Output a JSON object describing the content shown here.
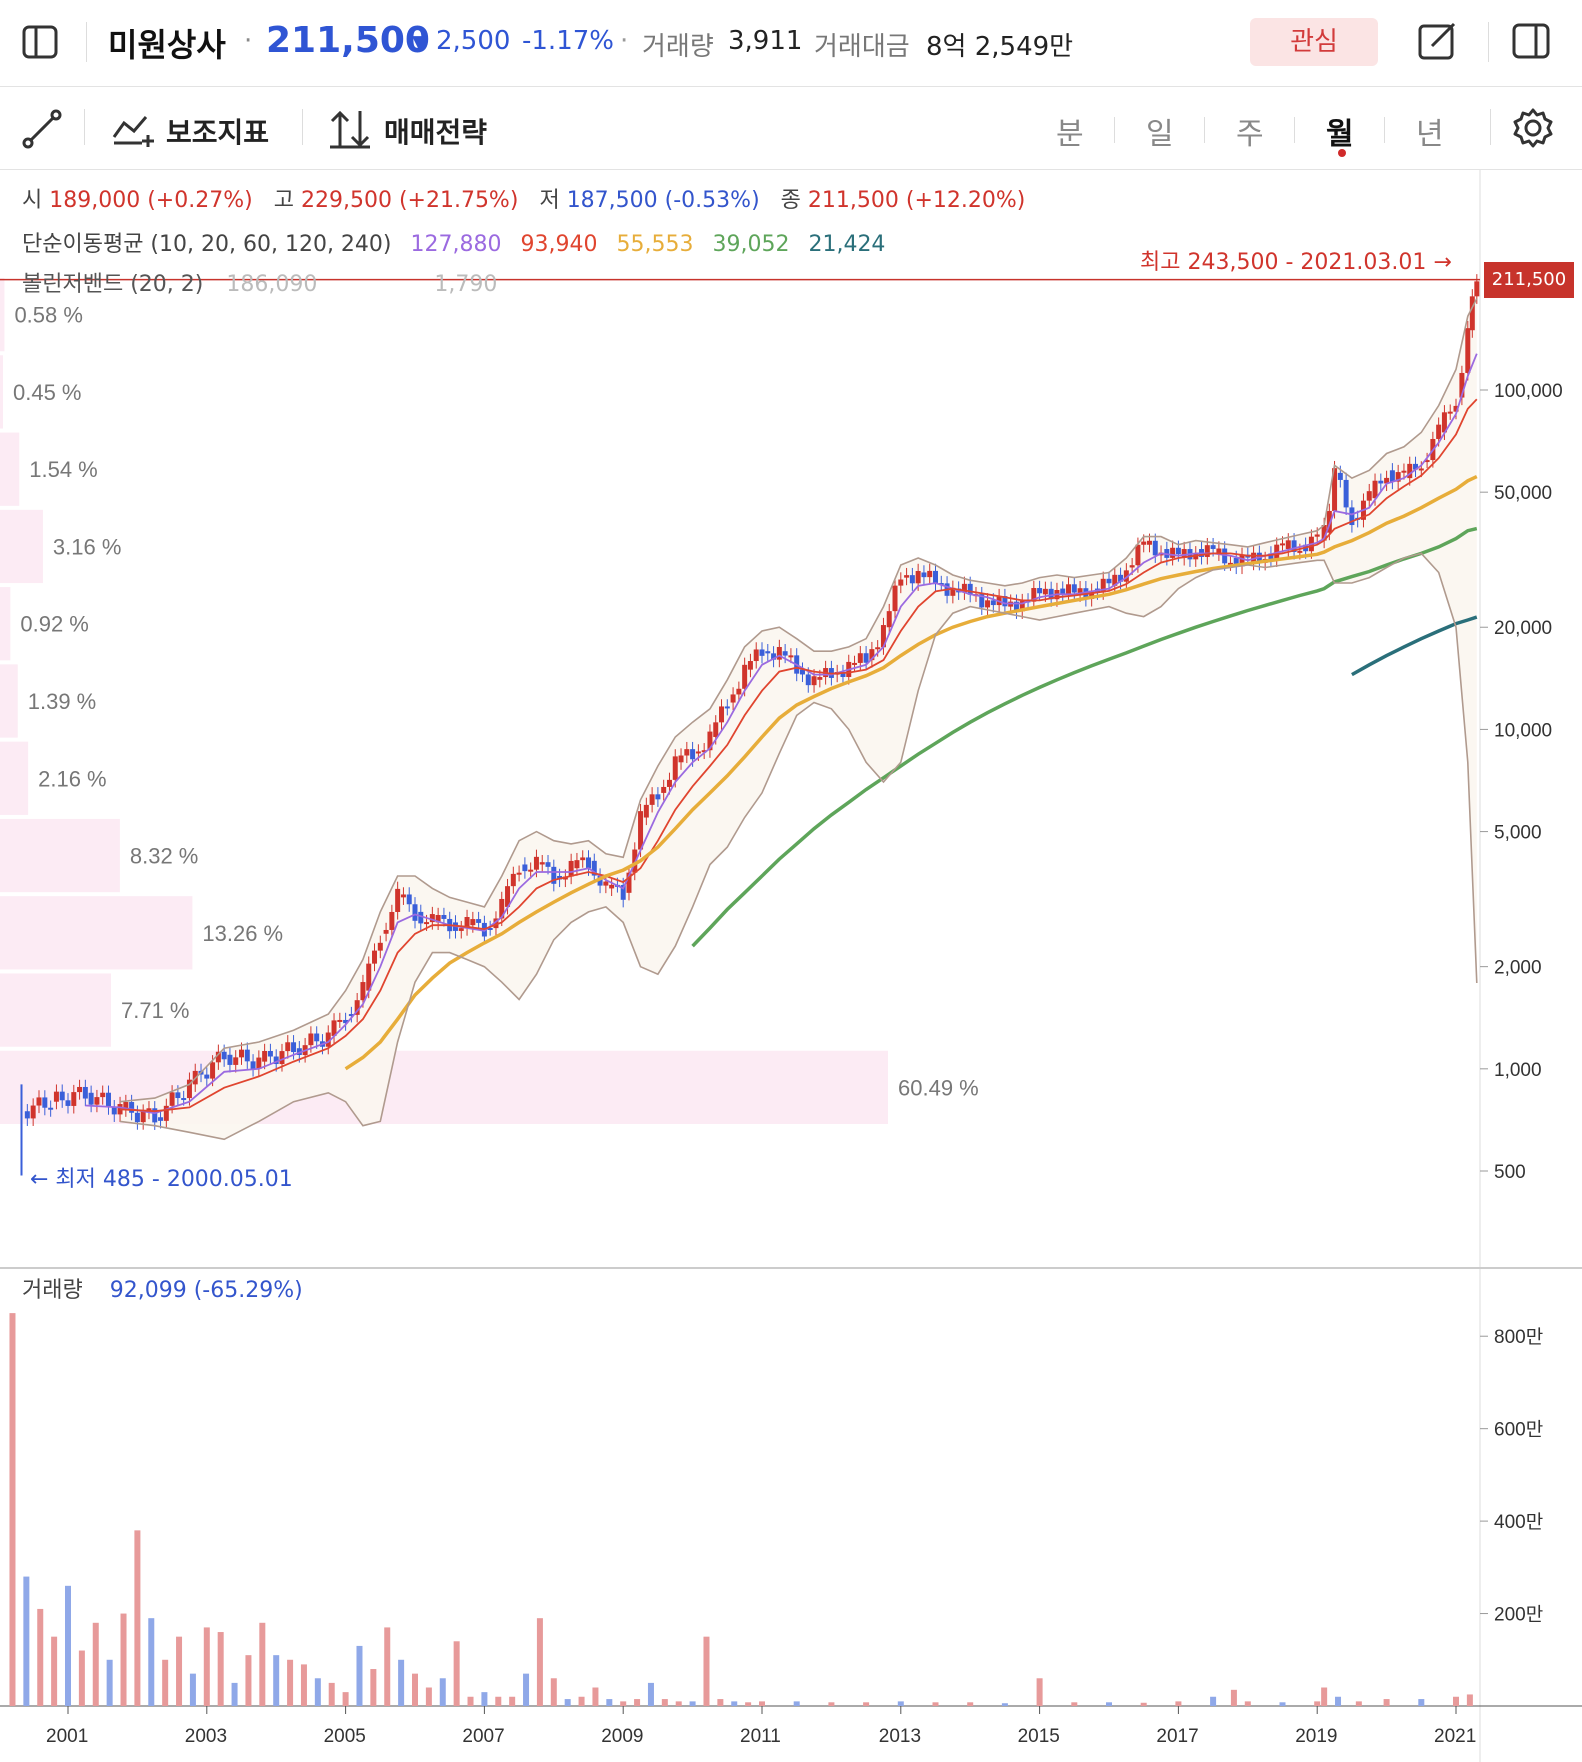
{
  "header": {
    "stock_name": "미원상사",
    "price": "211,500",
    "change_arrow": "▼",
    "change": "2,500",
    "change_pct": "-1.17%",
    "volume_label": "거래량",
    "volume": "3,911",
    "amount_label": "거래대금",
    "amount": "8억 2,549만",
    "watch_label": "관심",
    "icons": [
      "sidebar-toggle-icon",
      "edit-icon",
      "panel-icon"
    ]
  },
  "toolbar": {
    "indicator_label": "보조지표",
    "strategy_label": "매매전략",
    "periods": [
      "분",
      "일",
      "주",
      "월",
      "년"
    ],
    "active_period": "월",
    "icons": [
      "draw-line-icon",
      "indicator-icon",
      "strategy-icon",
      "settings-icon"
    ]
  },
  "ohlc": {
    "open_label": "시",
    "open": "189,000 (+0.27%)",
    "high_label": "고",
    "high": "229,500 (+21.75%)",
    "low_label": "저",
    "low": "187,500 (-0.53%)",
    "close_label": "종",
    "close": "211,500 (+12.20%)"
  },
  "ma_legend": {
    "label": "단순이동평균 (10, 20, 60, 120, 240)",
    "values": [
      "127,880",
      "93,940",
      "55,553",
      "39,052",
      "21,424"
    ],
    "colors": [
      "#9b6ae0",
      "#e0452f",
      "#e7ad3a",
      "#5ea55a",
      "#2a6f7a"
    ]
  },
  "bb_legend": {
    "label": "볼린저밴드 (20, 2)",
    "upper": "186,090",
    "lower": "1,790"
  },
  "annotations": {
    "high": "최고 243,500 - 2021.03.01 →",
    "low": "← 최저 485 - 2000.05.01",
    "current_price_tag": "211,500"
  },
  "volume_panel": {
    "label": "거래량",
    "value": "92,099 (-65.29%)",
    "ticks": [
      "800만",
      "600만",
      "400만",
      "200만"
    ]
  },
  "chart_data": [
    {
      "type": "line",
      "title": "",
      "yscale": "log",
      "y_ticks": [
        "100,000",
        "50,000",
        "20,000",
        "10,000",
        "5,000",
        "2,000",
        "1,000",
        "500"
      ],
      "x_ticks": [
        "2001",
        "2003",
        "2005",
        "2007",
        "2009",
        "2011",
        "2013",
        "2015",
        "2017",
        "2019",
        "2021"
      ],
      "x": [
        2000.33,
        2000.75,
        2001.25,
        2001.75,
        2002.25,
        2002.75,
        2003.25,
        2003.75,
        2004.25,
        2004.75,
        2005.0,
        2005.25,
        2005.5,
        2005.75,
        2006.0,
        2006.25,
        2006.5,
        2006.75,
        2007.0,
        2007.25,
        2007.5,
        2007.75,
        2008.0,
        2008.25,
        2008.5,
        2008.75,
        2009.0,
        2009.25,
        2009.5,
        2009.75,
        2010.0,
        2010.25,
        2010.5,
        2010.75,
        2011.0,
        2011.25,
        2011.5,
        2011.75,
        2012.0,
        2012.25,
        2012.5,
        2012.75,
        2013.0,
        2013.25,
        2013.5,
        2013.75,
        2014.0,
        2014.25,
        2014.5,
        2014.75,
        2015.0,
        2015.25,
        2015.5,
        2015.75,
        2016.0,
        2016.25,
        2016.5,
        2016.75,
        2017.0,
        2017.25,
        2017.5,
        2017.75,
        2018.0,
        2018.25,
        2018.5,
        2018.75,
        2019.0,
        2019.1,
        2019.25,
        2019.5,
        2019.75,
        2020.0,
        2020.25,
        2020.5,
        2020.75,
        2021.0,
        2021.17,
        2021.3
      ],
      "series": [
        {
          "name": "",
          "role": "price",
          "color": "#d0342c",
          "values": [
            750,
            800,
            850,
            760,
            720,
            900,
            1100,
            1050,
            1150,
            1250,
            1450,
            1700,
            2500,
            3200,
            2900,
            2700,
            2700,
            2650,
            2600,
            3000,
            4000,
            4000,
            3700,
            3900,
            4100,
            3400,
            3300,
            5500,
            6500,
            8000,
            8500,
            9500,
            12000,
            15000,
            17000,
            17000,
            15000,
            14000,
            14500,
            15500,
            16000,
            20000,
            28000,
            29000,
            27000,
            26000,
            25000,
            24000,
            23000,
            24000,
            25000,
            26000,
            25000,
            26000,
            26500,
            30000,
            35000,
            34000,
            32000,
            34000,
            33000,
            32000,
            31000,
            33000,
            34000,
            35000,
            36000,
            38000,
            57000,
            42000,
            48000,
            58000,
            55000,
            62000,
            75000,
            95000,
            150000,
            211500
          ]
        },
        {
          "name": "",
          "role": "ma10",
          "color": "#9b6ae0",
          "values": [
            null,
            null,
            780,
            770,
            740,
            800,
            980,
            1000,
            1100,
            1200,
            1350,
            1550,
            2000,
            2700,
            2850,
            2750,
            2650,
            2600,
            2550,
            2800,
            3400,
            3800,
            3800,
            3800,
            3900,
            3600,
            3400,
            4400,
            5700,
            7000,
            8000,
            8800,
            10500,
            13000,
            15500,
            16500,
            15500,
            14500,
            14500,
            15000,
            15500,
            17500,
            23000,
            26500,
            27000,
            26000,
            25000,
            24500,
            23500,
            23500,
            24500,
            25000,
            25000,
            25500,
            26000,
            28000,
            31000,
            33000,
            32500,
            33000,
            33000,
            32500,
            31500,
            32500,
            33500,
            34500,
            35500,
            36500,
            44000,
            43000,
            45000,
            53000,
            55000,
            60000,
            70000,
            85000,
            110000,
            127880
          ]
        },
        {
          "name": "",
          "role": "ma20",
          "color": "#e0452f",
          "values": [
            null,
            null,
            null,
            760,
            750,
            770,
            880,
            950,
            1050,
            1150,
            1250,
            1400,
            1700,
            2200,
            2500,
            2650,
            2650,
            2620,
            2580,
            2700,
            3000,
            3400,
            3600,
            3700,
            3800,
            3700,
            3550,
            3900,
            4700,
            5800,
            6800,
            7800,
            9000,
            11000,
            13000,
            14800,
            15200,
            14800,
            14600,
            14700,
            15000,
            16000,
            19500,
            23000,
            25500,
            26000,
            25500,
            25000,
            24500,
            24000,
            24000,
            24500,
            24800,
            25200,
            25600,
            26800,
            29000,
            31000,
            32000,
            32500,
            33000,
            33000,
            32500,
            32500,
            33000,
            34000,
            35000,
            36000,
            39000,
            41000,
            43000,
            48000,
            52000,
            56000,
            63000,
            74000,
            88000,
            93940
          ]
        },
        {
          "name": "",
          "role": "ma60",
          "color": "#e7ad3a",
          "values": [
            null,
            null,
            null,
            null,
            null,
            null,
            null,
            null,
            null,
            null,
            1000,
            1080,
            1200,
            1400,
            1650,
            1850,
            2050,
            2200,
            2350,
            2500,
            2700,
            2900,
            3100,
            3300,
            3500,
            3700,
            3850,
            4100,
            4500,
            5100,
            5800,
            6500,
            7300,
            8300,
            9500,
            10800,
            11800,
            12500,
            13200,
            13800,
            14400,
            15200,
            16500,
            17800,
            19000,
            20000,
            20800,
            21500,
            22000,
            22500,
            23000,
            23500,
            24000,
            24500,
            25000,
            25800,
            26800,
            27800,
            28500,
            29200,
            29800,
            30300,
            30800,
            31300,
            31800,
            32300,
            32800,
            33300,
            34500,
            36000,
            38000,
            40500,
            42500,
            45000,
            48000,
            51000,
            54000,
            55553
          ]
        },
        {
          "name": "",
          "role": "ma120",
          "color": "#5ea55a",
          "values": [
            null,
            null,
            null,
            null,
            null,
            null,
            null,
            null,
            null,
            null,
            null,
            null,
            null,
            null,
            null,
            null,
            null,
            null,
            null,
            null,
            null,
            null,
            null,
            null,
            null,
            null,
            null,
            null,
            null,
            null,
            2300,
            2600,
            2950,
            3300,
            3700,
            4150,
            4600,
            5100,
            5600,
            6100,
            6650,
            7200,
            7800,
            8450,
            9100,
            9800,
            10500,
            11200,
            11900,
            12600,
            13300,
            14000,
            14700,
            15400,
            16100,
            16800,
            17600,
            18400,
            19200,
            20000,
            20800,
            21600,
            22400,
            23200,
            24000,
            24800,
            25600,
            26000,
            27200,
            28200,
            29200,
            30500,
            31800,
            33000,
            34500,
            36500,
            38500,
            39052
          ]
        },
        {
          "name": "",
          "role": "ma240",
          "color": "#2a6f7a",
          "values": [
            null,
            null,
            null,
            null,
            null,
            null,
            null,
            null,
            null,
            null,
            null,
            null,
            null,
            null,
            null,
            null,
            null,
            null,
            null,
            null,
            null,
            null,
            null,
            null,
            null,
            null,
            null,
            null,
            null,
            null,
            null,
            null,
            null,
            null,
            null,
            null,
            null,
            null,
            null,
            null,
            null,
            null,
            null,
            null,
            null,
            null,
            null,
            null,
            null,
            null,
            null,
            null,
            null,
            null,
            null,
            null,
            null,
            null,
            null,
            null,
            null,
            null,
            null,
            null,
            null,
            null,
            null,
            null,
            null,
            14500,
            15500,
            16500,
            17500,
            18500,
            19500,
            20500,
            21000,
            21424
          ]
        },
        {
          "name": "",
          "role": "bb_upper",
          "color": "#b09a8e",
          "values": [
            null,
            null,
            null,
            800,
            820,
            900,
            1150,
            1200,
            1300,
            1450,
            1700,
            2100,
            2900,
            3700,
            3700,
            3400,
            3200,
            3100,
            3000,
            3700,
            4700,
            5000,
            4700,
            4600,
            4700,
            4300,
            4200,
            6200,
            7800,
            9500,
            10500,
            11500,
            14000,
            17500,
            19500,
            20000,
            18500,
            17000,
            17000,
            17500,
            18500,
            23000,
            30500,
            32000,
            30500,
            28500,
            27500,
            27000,
            26500,
            27000,
            28000,
            28500,
            28000,
            28500,
            29000,
            32000,
            37000,
            37000,
            35000,
            36000,
            35500,
            35000,
            34500,
            35500,
            36500,
            37500,
            38500,
            40000,
            60000,
            55000,
            58000,
            65000,
            68000,
            75000,
            90000,
            115000,
            165000,
            186090
          ]
        },
        {
          "name": "",
          "role": "bb_lower",
          "color": "#b09a8e",
          "values": [
            null,
            null,
            null,
            700,
            680,
            650,
            620,
            700,
            800,
            850,
            800,
            680,
            700,
            1200,
            1800,
            2200,
            2200,
            2100,
            2000,
            1800,
            1600,
            1900,
            2400,
            2700,
            2900,
            3000,
            2700,
            2000,
            1900,
            2300,
            3000,
            4000,
            4500,
            5500,
            6500,
            8500,
            11000,
            12000,
            11500,
            10000,
            8000,
            7000,
            8000,
            13000,
            19000,
            22000,
            23000,
            22500,
            22000,
            21500,
            21000,
            21500,
            22000,
            22500,
            23000,
            22000,
            21500,
            23000,
            26000,
            28000,
            29500,
            30000,
            30500,
            30000,
            30500,
            31000,
            31500,
            31500,
            27000,
            27000,
            28000,
            30000,
            32000,
            33000,
            29000,
            20000,
            8000,
            1790
          ]
        }
      ],
      "high": {
        "value": 243500,
        "date": "2021.03.01"
      },
      "low": {
        "value": 485,
        "date": "2000.05.01"
      },
      "volume_profile": [
        {
          "pct": "0.58 %",
          "width": 0.003
        },
        {
          "pct": "0.45 %",
          "width": 0.002
        },
        {
          "pct": "1.54 %",
          "width": 0.013
        },
        {
          "pct": "3.16 %",
          "width": 0.029
        },
        {
          "pct": "0.92 %",
          "width": 0.007
        },
        {
          "pct": "1.39 %",
          "width": 0.012
        },
        {
          "pct": "2.16 %",
          "width": 0.019
        },
        {
          "pct": "8.32 %",
          "width": 0.081
        },
        {
          "pct": "13.26 %",
          "width": 0.13
        },
        {
          "pct": "7.71 %",
          "width": 0.075
        },
        {
          "pct": "60.49 %",
          "width": 0.6
        }
      ]
    },
    {
      "type": "bar",
      "title": "",
      "ylabel": "거래량",
      "y_ticks": [
        "800만",
        "600만",
        "400만",
        "200만"
      ],
      "ylim": [
        0,
        9000000
      ],
      "x": [
        2000.2,
        2000.4,
        2000.6,
        2000.8,
        2001.0,
        2001.2,
        2001.4,
        2001.6,
        2001.8,
        2002.0,
        2002.2,
        2002.4,
        2002.6,
        2002.8,
        2003.0,
        2003.2,
        2003.4,
        2003.6,
        2003.8,
        2004.0,
        2004.2,
        2004.4,
        2004.6,
        2004.8,
        2005.0,
        2005.2,
        2005.4,
        2005.6,
        2005.8,
        2006.0,
        2006.2,
        2006.4,
        2006.6,
        2006.8,
        2007.0,
        2007.2,
        2007.4,
        2007.6,
        2007.8,
        2008.0,
        2008.2,
        2008.4,
        2008.6,
        2008.8,
        2009.0,
        2009.2,
        2009.4,
        2009.6,
        2009.8,
        2010.0,
        2010.2,
        2010.4,
        2010.6,
        2010.8,
        2011.0,
        2011.5,
        2012.0,
        2012.5,
        2013.0,
        2013.5,
        2014.0,
        2014.5,
        2015.0,
        2015.5,
        2016.0,
        2016.5,
        2017.0,
        2017.5,
        2017.8,
        2018.0,
        2018.5,
        2019.0,
        2019.1,
        2019.3,
        2019.6,
        2020.0,
        2020.5,
        2021.0,
        2021.2
      ],
      "values": [
        8500000,
        2800000,
        2100000,
        1500000,
        2600000,
        1200000,
        1800000,
        1000000,
        2000000,
        3800000,
        1900000,
        1000000,
        1500000,
        700000,
        1700000,
        1600000,
        500000,
        1100000,
        1800000,
        1100000,
        1000000,
        900000,
        600000,
        500000,
        300000,
        1300000,
        800000,
        1700000,
        1000000,
        700000,
        400000,
        600000,
        1400000,
        200000,
        300000,
        200000,
        200000,
        700000,
        1900000,
        600000,
        150000,
        200000,
        400000,
        150000,
        100000,
        150000,
        500000,
        150000,
        100000,
        100000,
        1500000,
        150000,
        100000,
        80000,
        100000,
        100000,
        80000,
        80000,
        100000,
        80000,
        80000,
        60000,
        600000,
        80000,
        80000,
        70000,
        100000,
        200000,
        350000,
        100000,
        80000,
        100000,
        400000,
        200000,
        100000,
        150000,
        150000,
        200000,
        250000
      ],
      "colors_up": "#e79a9a",
      "colors_down": "#8fa8e8"
    }
  ]
}
